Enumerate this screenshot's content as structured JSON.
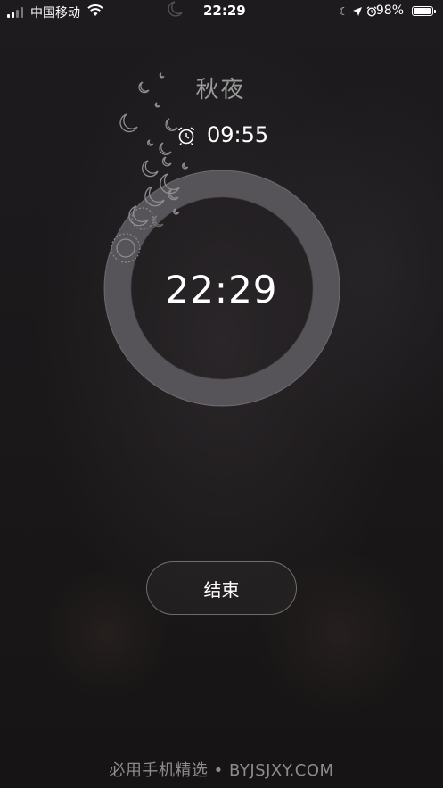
{
  "status_bar": {
    "carrier": "中国移动",
    "time": "22:29",
    "battery_percent": "98%",
    "icons": [
      "signal-icon",
      "wifi-icon",
      "moon-icon",
      "location-icon",
      "alarm-icon",
      "battery-icon"
    ],
    "battery_level": 0.98
  },
  "sleep": {
    "title": "秋夜",
    "alarm_time": "09:55",
    "current_time": "22:29",
    "end_button_label": "结束"
  },
  "footer": {
    "watermark": "必用手机精选 • BYJSJXY.COM"
  },
  "colors": {
    "background": "#1a1818",
    "title_gray": "#9a9a9a",
    "ring": "#6a686b"
  }
}
